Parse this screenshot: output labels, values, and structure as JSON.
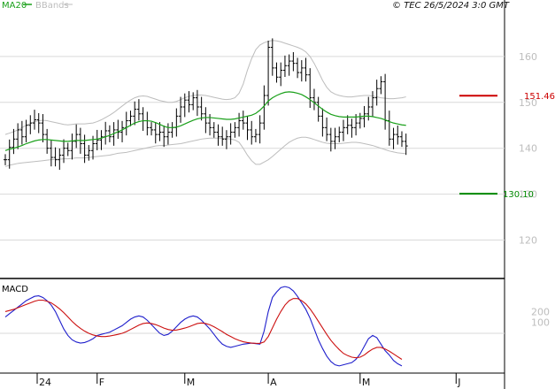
{
  "header": {
    "legend_ma": "MA20",
    "legend_bb": "BBands",
    "credit": "© TEC 26/5/2024 3:0 GMT"
  },
  "colors": {
    "ma": "#1aa01a",
    "bb": "#bdbdbd",
    "price": "#000000",
    "macd": "#1f1fcc",
    "signal": "#cc1010",
    "resistance": "#cc0000",
    "support": "#008800",
    "grid": "#d9d9d9"
  },
  "chart_data": [
    {
      "type": "ohlc",
      "y_ticks": [
        {
          "value": 160,
          "label": "160"
        },
        {
          "value": 150,
          "label": "150"
        },
        {
          "value": 140,
          "label": "140"
        },
        {
          "value": 130,
          "label": "130"
        },
        {
          "value": 120,
          "label": "120"
        }
      ],
      "ylim": [
        112,
        170
      ],
      "x_ticks": [
        {
          "index": 0,
          "label": "24"
        },
        {
          "index": 22,
          "label": "F"
        },
        {
          "index": 43,
          "label": "M"
        },
        {
          "index": 63,
          "label": "A"
        },
        {
          "index": 85,
          "label": "M"
        },
        {
          "index": 108,
          "label": "J"
        }
      ],
      "x_count": 110,
      "levels": [
        {
          "name": "resistance",
          "value": 151.46,
          "label": "151.46",
          "from_index": 98,
          "to_index": 107
        },
        {
          "name": "support",
          "value": 130.1,
          "label": "130.10",
          "from_index": 98,
          "to_index": 107
        }
      ],
      "close": [
        137.5,
        140.2,
        142.0,
        144.0,
        142.5,
        145.0,
        145.5,
        146.2,
        145.5,
        143.0,
        140.0,
        138.0,
        137.5,
        138.5,
        140.0,
        139.5,
        141.5,
        143.0,
        141.0,
        138.5,
        139.5,
        141.0,
        141.8,
        142.5,
        143.8,
        142.5,
        144.0,
        143.5,
        144.5,
        146.0,
        147.0,
        148.5,
        147.5,
        146.0,
        144.5,
        144.0,
        143.0,
        143.5,
        142.5,
        143.5,
        144.5,
        147.0,
        149.0,
        150.5,
        149.5,
        151.0,
        149.0,
        147.5,
        145.5,
        144.5,
        143.5,
        142.5,
        142.0,
        142.5,
        143.5,
        144.5,
        146.0,
        145.5,
        144.0,
        142.5,
        143.0,
        145.5,
        151.5,
        162.0,
        157.5,
        155.5,
        157.0,
        158.0,
        159.0,
        158.5,
        156.5,
        157.5,
        156.0,
        151.0,
        150.0,
        147.0,
        144.5,
        143.0,
        141.5,
        142.5,
        143.5,
        144.5,
        145.0,
        144.5,
        145.5,
        146.5,
        147.5,
        149.0,
        151.0,
        153.0,
        154.5,
        146.0,
        142.0,
        143.0,
        142.5,
        141.5,
        140.5
      ],
      "ma20": [
        139.5,
        139.8,
        140.0,
        140.3,
        140.6,
        141.0,
        141.3,
        141.6,
        141.8,
        141.9,
        141.9,
        141.8,
        141.7,
        141.6,
        141.5,
        141.5,
        141.6,
        141.7,
        141.7,
        141.7,
        141.8,
        141.9,
        142.0,
        142.2,
        142.5,
        142.8,
        143.2,
        143.6,
        144.0,
        144.5,
        145.0,
        145.5,
        145.8,
        146.0,
        146.0,
        145.9,
        145.6,
        145.2,
        144.8,
        144.5,
        144.5,
        144.6,
        144.9,
        145.3,
        145.7,
        146.1,
        146.4,
        146.6,
        146.7,
        146.7,
        146.6,
        146.5,
        146.4,
        146.3,
        146.3,
        146.4,
        146.6,
        146.8,
        147.0,
        147.2,
        147.6,
        148.3,
        149.2,
        150.3,
        151.0,
        151.5,
        151.9,
        152.2,
        152.3,
        152.2,
        152.0,
        151.7,
        151.2,
        150.6,
        149.9,
        149.2,
        148.5,
        147.9,
        147.4,
        147.1,
        146.9,
        146.8,
        146.8,
        146.8,
        146.8,
        146.9,
        147.0,
        147.0,
        146.9,
        146.7,
        146.5,
        146.2,
        145.8,
        145.5,
        145.3,
        145.1,
        145.0
      ],
      "bb_upper": [
        143.0,
        143.3,
        143.6,
        144.0,
        144.5,
        145.0,
        145.4,
        145.8,
        146.0,
        146.1,
        146.0,
        145.8,
        145.6,
        145.4,
        145.2,
        145.1,
        145.2,
        145.3,
        145.3,
        145.3,
        145.4,
        145.5,
        145.8,
        146.2,
        146.7,
        147.2,
        147.8,
        148.5,
        149.2,
        149.9,
        150.5,
        151.0,
        151.3,
        151.4,
        151.3,
        151.0,
        150.7,
        150.4,
        150.2,
        150.0,
        150.0,
        150.2,
        150.6,
        151.0,
        151.3,
        151.5,
        151.6,
        151.6,
        151.5,
        151.3,
        151.1,
        150.9,
        150.7,
        150.6,
        150.7,
        151.0,
        152.0,
        154.0,
        157.0,
        159.5,
        161.5,
        162.5,
        163.0,
        163.3,
        163.5,
        163.4,
        163.2,
        162.9,
        162.6,
        162.3,
        162.0,
        161.6,
        161.0,
        160.0,
        158.5,
        156.7,
        154.8,
        153.3,
        152.3,
        151.8,
        151.5,
        151.3,
        151.2,
        151.2,
        151.3,
        151.4,
        151.5,
        151.5,
        151.4,
        151.2,
        151.0,
        150.9,
        150.8,
        150.8,
        150.9,
        151.0,
        151.2
      ],
      "bb_lower": [
        136.0,
        136.3,
        136.5,
        136.7,
        136.8,
        136.9,
        137.0,
        137.1,
        137.2,
        137.3,
        137.4,
        137.5,
        137.6,
        137.6,
        137.7,
        137.7,
        137.8,
        137.9,
        137.9,
        137.9,
        138.0,
        138.1,
        138.2,
        138.3,
        138.4,
        138.5,
        138.7,
        138.9,
        139.0,
        139.1,
        139.3,
        139.5,
        139.7,
        139.9,
        140.1,
        140.3,
        140.5,
        140.6,
        140.6,
        140.7,
        140.8,
        140.9,
        141.0,
        141.2,
        141.4,
        141.6,
        141.8,
        142.0,
        142.1,
        142.2,
        142.2,
        142.2,
        142.1,
        142.1,
        142.0,
        141.8,
        141.3,
        140.0,
        138.5,
        137.3,
        136.5,
        136.5,
        137.0,
        137.5,
        138.2,
        139.0,
        139.8,
        140.6,
        141.3,
        141.8,
        142.2,
        142.4,
        142.4,
        142.2,
        141.9,
        141.6,
        141.3,
        141.1,
        141.0,
        141.0,
        141.0,
        141.1,
        141.2,
        141.3,
        141.3,
        141.2,
        141.0,
        140.8,
        140.6,
        140.3,
        140.0,
        139.7,
        139.4,
        139.2,
        139.0,
        138.9,
        138.8
      ]
    },
    {
      "type": "line",
      "series_names": [
        "MACD",
        "signal"
      ],
      "y_ticks": [
        {
          "value": 200,
          "label": "200"
        },
        {
          "value": 100,
          "label": "100"
        }
      ],
      "ylim": [
        -350,
        480
      ],
      "label": "MACD",
      "macd": [
        150,
        180,
        210,
        240,
        270,
        300,
        320,
        340,
        345,
        330,
        300,
        260,
        200,
        120,
        40,
        -20,
        -60,
        -80,
        -90,
        -85,
        -70,
        -50,
        -20,
        -10,
        0,
        10,
        30,
        50,
        70,
        100,
        130,
        150,
        160,
        150,
        120,
        80,
        40,
        0,
        -20,
        -10,
        20,
        60,
        100,
        130,
        150,
        160,
        150,
        120,
        80,
        40,
        -10,
        -60,
        -100,
        -120,
        -130,
        -120,
        -110,
        -100,
        -95,
        -90,
        -95,
        -100,
        20,
        200,
        330,
        380,
        420,
        430,
        420,
        390,
        340,
        280,
        220,
        140,
        40,
        -60,
        -140,
        -210,
        -260,
        -290,
        -300,
        -290,
        -280,
        -270,
        -240,
        -190,
        -120,
        -50,
        -20,
        -40,
        -100,
        -160,
        -200,
        -250,
        -280,
        -300
      ],
      "signal": [
        200,
        210,
        220,
        235,
        250,
        265,
        280,
        295,
        305,
        305,
        295,
        280,
        255,
        225,
        190,
        150,
        110,
        75,
        45,
        20,
        0,
        -15,
        -25,
        -30,
        -30,
        -25,
        -18,
        -10,
        0,
        15,
        35,
        55,
        75,
        90,
        95,
        90,
        80,
        65,
        48,
        35,
        28,
        30,
        38,
        48,
        60,
        75,
        90,
        95,
        90,
        78,
        60,
        38,
        15,
        -10,
        -30,
        -50,
        -65,
        -78,
        -85,
        -90,
        -92,
        -93,
        -80,
        -30,
        50,
        130,
        200,
        260,
        300,
        320,
        320,
        300,
        270,
        225,
        170,
        110,
        50,
        -10,
        -65,
        -110,
        -150,
        -185,
        -205,
        -220,
        -225,
        -220,
        -200,
        -170,
        -145,
        -130,
        -130,
        -145,
        -165,
        -190,
        -215,
        -240
      ]
    }
  ]
}
